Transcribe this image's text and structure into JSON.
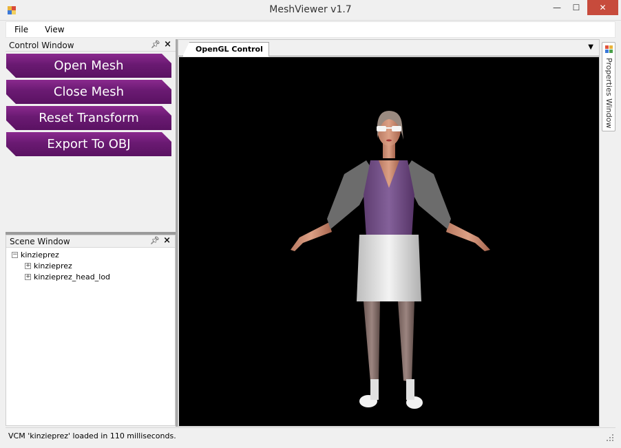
{
  "window": {
    "title": "MeshViewer v1.7",
    "minimize_glyph": "—",
    "maximize_glyph": "☐",
    "close_glyph": "✕"
  },
  "menu": {
    "items": [
      {
        "label": "File"
      },
      {
        "label": "View"
      }
    ]
  },
  "control_window": {
    "title": "Control Window",
    "buttons": [
      {
        "label": "Open Mesh"
      },
      {
        "label": "Close Mesh"
      },
      {
        "label": "Reset Transform"
      },
      {
        "label": "Export To OBJ"
      }
    ],
    "accent_color": "#6a1a72"
  },
  "scene_window": {
    "title": "Scene Window",
    "root": {
      "label": "kinzieprez",
      "expander": "⊟"
    },
    "children": [
      {
        "label": "kinzieprez",
        "expander": "⊞"
      },
      {
        "label": "kinzieprez_head_lod",
        "expander": "⊞"
      }
    ]
  },
  "document": {
    "active_tab": "OpenGL Control",
    "dropdown_glyph": "▼",
    "viewport_background": "#000000"
  },
  "properties": {
    "tab_label": "Properties Window"
  },
  "status": {
    "text": "VCM 'kinzieprez' loaded in 110 milliseconds."
  }
}
